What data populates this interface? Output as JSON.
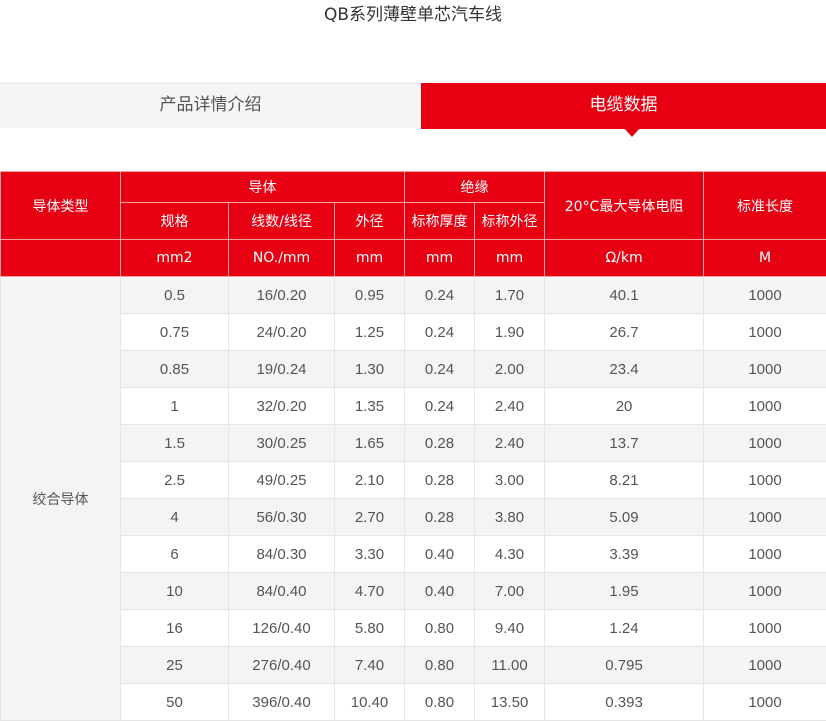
{
  "page": {
    "title": "QB系列薄壁单芯汽车线"
  },
  "tabs": [
    {
      "label": "产品详情介绍",
      "active": false
    },
    {
      "label": "电缆数据",
      "active": true
    }
  ],
  "colors": {
    "accent": "#e60012"
  },
  "table": {
    "header": {
      "conductor_type": "导体类型",
      "conductor": "导体",
      "insulation": "绝缘",
      "resistance": "20°C最大导体电阻",
      "standard_length": "标准长度",
      "spec": "规格",
      "strands": "线数/线径",
      "outer_diameter": "外径",
      "nominal_thickness": "标称厚度",
      "nominal_outer_diameter": "标称外径"
    },
    "units": {
      "spec": "mm2",
      "strands": "NO./mm",
      "outer_diameter": "mm",
      "nominal_thickness": "mm",
      "nominal_outer_diameter": "mm",
      "resistance": "Ω/km",
      "standard_length": "M"
    },
    "type_label": "绞合导体",
    "rows": [
      [
        "0.5",
        "16/0.20",
        "0.95",
        "0.24",
        "1.70",
        "40.1",
        "1000"
      ],
      [
        "0.75",
        "24/0.20",
        "1.25",
        "0.24",
        "1.90",
        "26.7",
        "1000"
      ],
      [
        "0.85",
        "19/0.24",
        "1.30",
        "0.24",
        "2.00",
        "23.4",
        "1000"
      ],
      [
        "1",
        "32/0.20",
        "1.35",
        "0.24",
        "2.40",
        "20",
        "1000"
      ],
      [
        "1.5",
        "30/0.25",
        "1.65",
        "0.28",
        "2.40",
        "13.7",
        "1000"
      ],
      [
        "2.5",
        "49/0.25",
        "2.10",
        "0.28",
        "3.00",
        "8.21",
        "1000"
      ],
      [
        "4",
        "56/0.30",
        "2.70",
        "0.28",
        "3.80",
        "5.09",
        "1000"
      ],
      [
        "6",
        "84/0.30",
        "3.30",
        "0.40",
        "4.30",
        "3.39",
        "1000"
      ],
      [
        "10",
        "84/0.40",
        "4.70",
        "0.40",
        "7.00",
        "1.95",
        "1000"
      ],
      [
        "16",
        "126/0.40",
        "5.80",
        "0.80",
        "9.40",
        "1.24",
        "1000"
      ],
      [
        "25",
        "276/0.40",
        "7.40",
        "0.80",
        "11.00",
        "0.795",
        "1000"
      ],
      [
        "50",
        "396/0.40",
        "10.40",
        "0.80",
        "13.50",
        "0.393",
        "1000"
      ]
    ]
  }
}
